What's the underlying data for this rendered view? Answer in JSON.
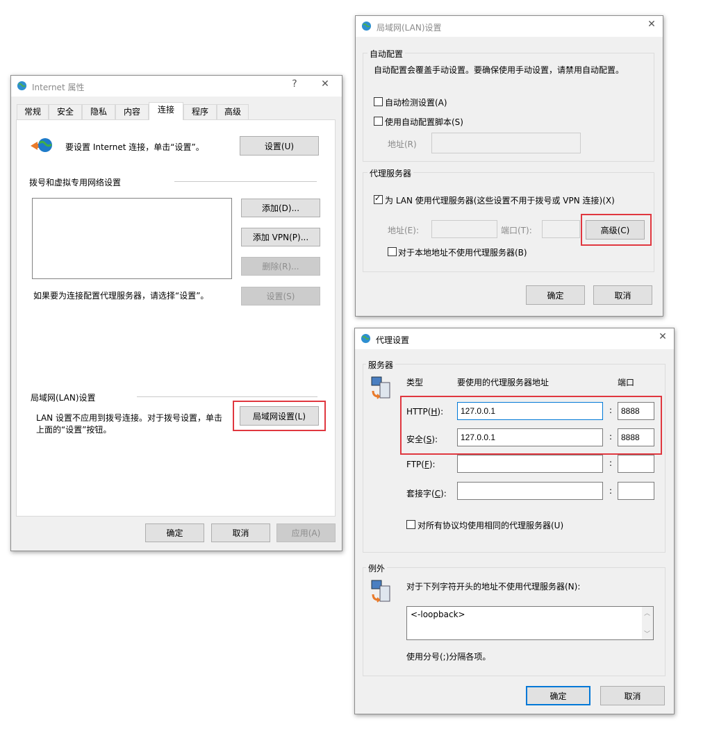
{
  "internet_props": {
    "title": "Internet 属性",
    "help": "?",
    "close": "✕",
    "tabs": [
      "常规",
      "安全",
      "隐私",
      "内容",
      "连接",
      "程序",
      "高级"
    ],
    "setup_text": "要设置 Internet 连接，单击“设置”。",
    "setup_button": "设置(U)",
    "dialup_heading": "拨号和虚拟专用网络设置",
    "add_button": "添加(D)...",
    "add_vpn_button": "添加 VPN(P)...",
    "delete_button": "删除(R)...",
    "settings_button": "设置(S)",
    "proxy_hint": "如果要为连接配置代理服务器，请选择“设置”。",
    "lan_heading": "局域网(LAN)设置",
    "lan_text_1": "LAN 设置不应用到拨号连接。对于拨号设置，单击",
    "lan_text_2": "上面的“设置”按钮。",
    "lan_button": "局域网设置(L)",
    "ok": "确定",
    "cancel": "取消",
    "apply": "应用(A)"
  },
  "lan_settings": {
    "title": "局域网(LAN)设置",
    "close": "✕",
    "auto_group": "自动配置",
    "auto_desc": "自动配置会覆盖手动设置。要确保使用手动设置，请禁用自动配置。",
    "auto_detect": "自动检测设置(A)",
    "auto_detect_checked": false,
    "use_script": "使用自动配置脚本(S)",
    "use_script_checked": false,
    "address_label": "地址(R)",
    "proxy_group": "代理服务器",
    "use_proxy": "为 LAN 使用代理服务器(这些设置不用于拨号或 VPN 连接)(X)",
    "use_proxy_checked": true,
    "proxy_address_label": "地址(E):",
    "port_label": "端口(T):",
    "advanced_button": "高级(C)",
    "bypass_local": "对于本地地址不使用代理服务器(B)",
    "bypass_local_checked": false,
    "ok": "确定",
    "cancel": "取消"
  },
  "proxy_settings": {
    "title": "代理设置",
    "close": "✕",
    "servers_group": "服务器",
    "col_type": "类型",
    "col_address": "要使用的代理服务器地址",
    "col_port": "端口",
    "rows": [
      {
        "label_pre": "HTTP(",
        "key": "H",
        "label_post": "):",
        "address": "127.0.0.1",
        "port": "8888"
      },
      {
        "label_pre": "安全(",
        "key": "S",
        "label_post": "):",
        "address": "127.0.0.1",
        "port": "8888"
      },
      {
        "label_pre": "FTP(",
        "key": "F",
        "label_post": "):",
        "address": "",
        "port": ""
      },
      {
        "label_pre": "套接字(",
        "key": "C",
        "label_post": "):",
        "address": "",
        "port": ""
      }
    ],
    "colon": ":",
    "same_proxy": "对所有协议均使用相同的代理服务器(U)",
    "same_proxy_checked": false,
    "exceptions_group": "例外",
    "exceptions_desc": "对于下列字符开头的地址不使用代理服务器(N):",
    "exceptions_value": "<-loopback>",
    "separator_hint": "使用分号(;)分隔各项。",
    "ok": "确定",
    "cancel": "取消"
  },
  "colors": {
    "highlight": "#e0373f",
    "accent": "#0078d7",
    "dialog_bg": "#f0f0f0"
  }
}
